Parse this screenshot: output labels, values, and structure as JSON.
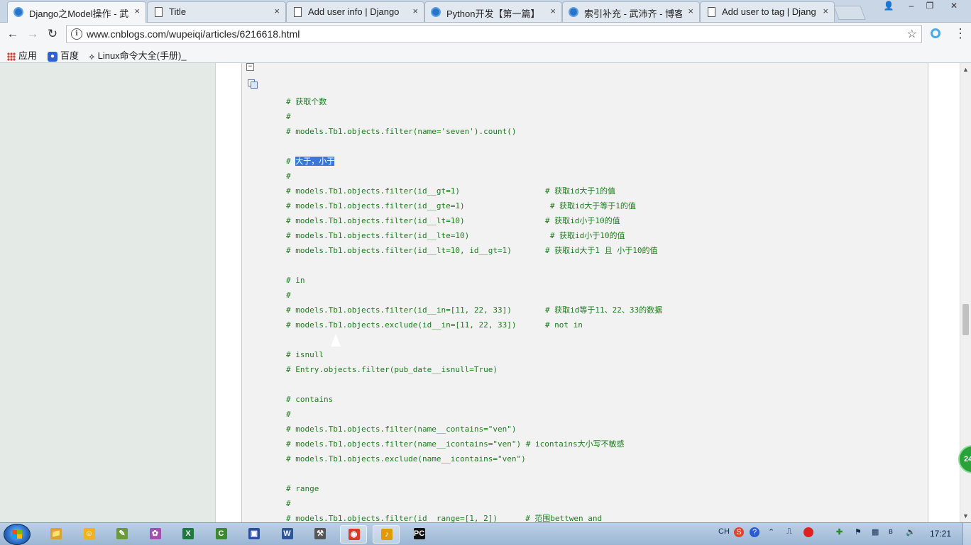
{
  "browser": {
    "tabs": [
      {
        "title": "Django之Model操作 - 武",
        "favicon": "cnblogs-icon",
        "active": true
      },
      {
        "title": "Title",
        "favicon": "page-icon",
        "active": false
      },
      {
        "title": "Add user info | Django",
        "favicon": "page-icon",
        "active": false
      },
      {
        "title": "Python开发【第一篇】",
        "favicon": "cnblogs-icon",
        "active": false
      },
      {
        "title": "索引补充 - 武沛齐 - 博客",
        "favicon": "cnblogs-icon",
        "active": false
      },
      {
        "title": "Add user to tag | Djang",
        "favicon": "page-icon",
        "active": false
      }
    ],
    "tab_close_glyph": "×",
    "window_controls": {
      "user": "👤",
      "minimize": "–",
      "restore": "❐",
      "close": "✕"
    },
    "nav": {
      "back": "←",
      "forward": "→",
      "reload": "↻"
    },
    "url": "www.cnblogs.com/wupeiqi/articles/6216618.html",
    "info_glyph": "i",
    "star_glyph": "☆",
    "menu_glyph": "⋮",
    "bookmarks": [
      {
        "label": "应用",
        "icon": "apps-grid-icon"
      },
      {
        "label": "百度",
        "icon": "baidu-paw-icon"
      },
      {
        "label": "Linux命令大全(手册)_",
        "icon": "linux-icon"
      }
    ]
  },
  "code": {
    "collapse_glyph": "−",
    "lines": [
      {
        "text": "# 获取个数"
      },
      {
        "text": "#"
      },
      {
        "text": "# models.Tb1.objects.filter(name='seven').count()"
      },
      {
        "text": ""
      },
      {
        "text": "# 大于，小于",
        "highlight": "大于，小于"
      },
      {
        "text": "#"
      },
      {
        "text": "# models.Tb1.objects.filter(id__gt=1)",
        "comment": "# 获取id大于1的值"
      },
      {
        "text": "# models.Tb1.objects.filter(id__gte=1)",
        "comment": "# 获取id大于等于1的值"
      },
      {
        "text": "# models.Tb1.objects.filter(id__lt=10)",
        "comment": "# 获取id小于10的值"
      },
      {
        "text": "# models.Tb1.objects.filter(id__lte=10)",
        "comment": "# 获取id小于10的值"
      },
      {
        "text": "# models.Tb1.objects.filter(id__lt=10, id__gt=1)",
        "comment": "# 获取id大于1 且 小于10的值"
      },
      {
        "text": ""
      },
      {
        "text": "# in"
      },
      {
        "text": "#"
      },
      {
        "text": "# models.Tb1.objects.filter(id__in=[11, 22, 33])",
        "comment": "# 获取id等于11、22、33的数据"
      },
      {
        "text": "# models.Tb1.objects.exclude(id__in=[11, 22, 33])",
        "comment": "# not in"
      },
      {
        "text": ""
      },
      {
        "text": "# isnull"
      },
      {
        "text": "# Entry.objects.filter(pub_date__isnull=True)"
      },
      {
        "text": ""
      },
      {
        "text": "# contains"
      },
      {
        "text": "#"
      },
      {
        "text": "# models.Tb1.objects.filter(name__contains=\"ven\")"
      },
      {
        "text": "# models.Tb1.objects.filter(name__icontains=\"ven\") # icontains大小写不敏感"
      },
      {
        "text": "# models.Tb1.objects.exclude(name__icontains=\"ven\")"
      },
      {
        "text": ""
      },
      {
        "text": "# range"
      },
      {
        "text": "#"
      },
      {
        "text": "# models.Tb1.objects.filter(id__range=[1, 2])",
        "comment": "# 范围bettwen and"
      }
    ]
  },
  "floating_badge": "24",
  "taskbar": {
    "apps": [
      {
        "name": "explorer",
        "glyph": "📁",
        "color": "#d9a233"
      },
      {
        "name": "qq",
        "glyph": "☺",
        "color": "#f0b21e"
      },
      {
        "name": "notepad",
        "glyph": "✎",
        "color": "#6b9a3b"
      },
      {
        "name": "paint",
        "glyph": "✿",
        "color": "#a44fb0"
      },
      {
        "name": "excel",
        "glyph": "X",
        "color": "#1e7a3c"
      },
      {
        "name": "camtasia",
        "glyph": "C",
        "color": "#3c8a30"
      },
      {
        "name": "save",
        "glyph": "▣",
        "color": "#2b4fa0"
      },
      {
        "name": "word",
        "glyph": "W",
        "color": "#2b579a"
      },
      {
        "name": "tools",
        "glyph": "⚒",
        "color": "#555"
      },
      {
        "name": "chrome",
        "glyph": "◉",
        "color": "#d93a2a"
      },
      {
        "name": "audio",
        "glyph": "♪",
        "color": "#e09b00"
      },
      {
        "name": "pycharm",
        "glyph": "PC",
        "color": "#111"
      }
    ],
    "tray": {
      "lang": "CH",
      "clock": "17:21"
    }
  }
}
